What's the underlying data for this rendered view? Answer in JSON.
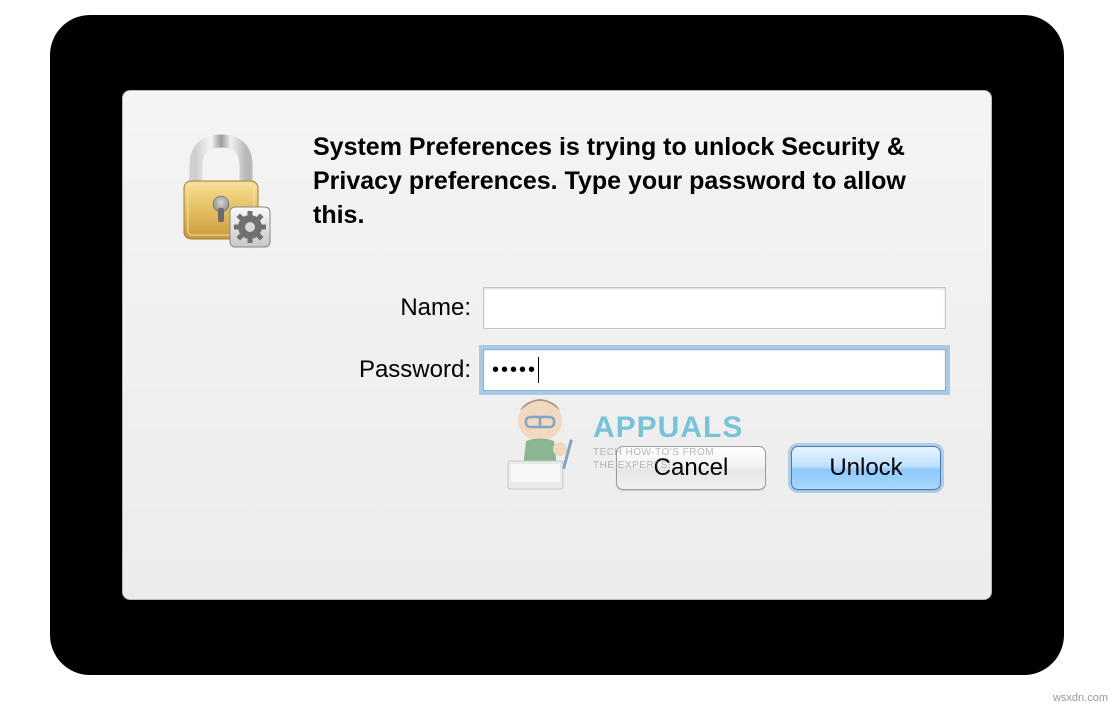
{
  "dialog": {
    "message": "System Preferences is trying to unlock Security & Privacy preferences. Type your password to allow this.",
    "fields": {
      "name": {
        "label": "Name:",
        "value": ""
      },
      "password": {
        "label": "Password:",
        "value": "•••••"
      }
    },
    "buttons": {
      "cancel": "Cancel",
      "unlock": "Unlock"
    }
  },
  "watermark": {
    "title": "APPUALS",
    "subtitle1": "TECH HOW-TO'S FROM",
    "subtitle2": "THE EXPERTS!"
  },
  "attribution": "wsxdn.com"
}
